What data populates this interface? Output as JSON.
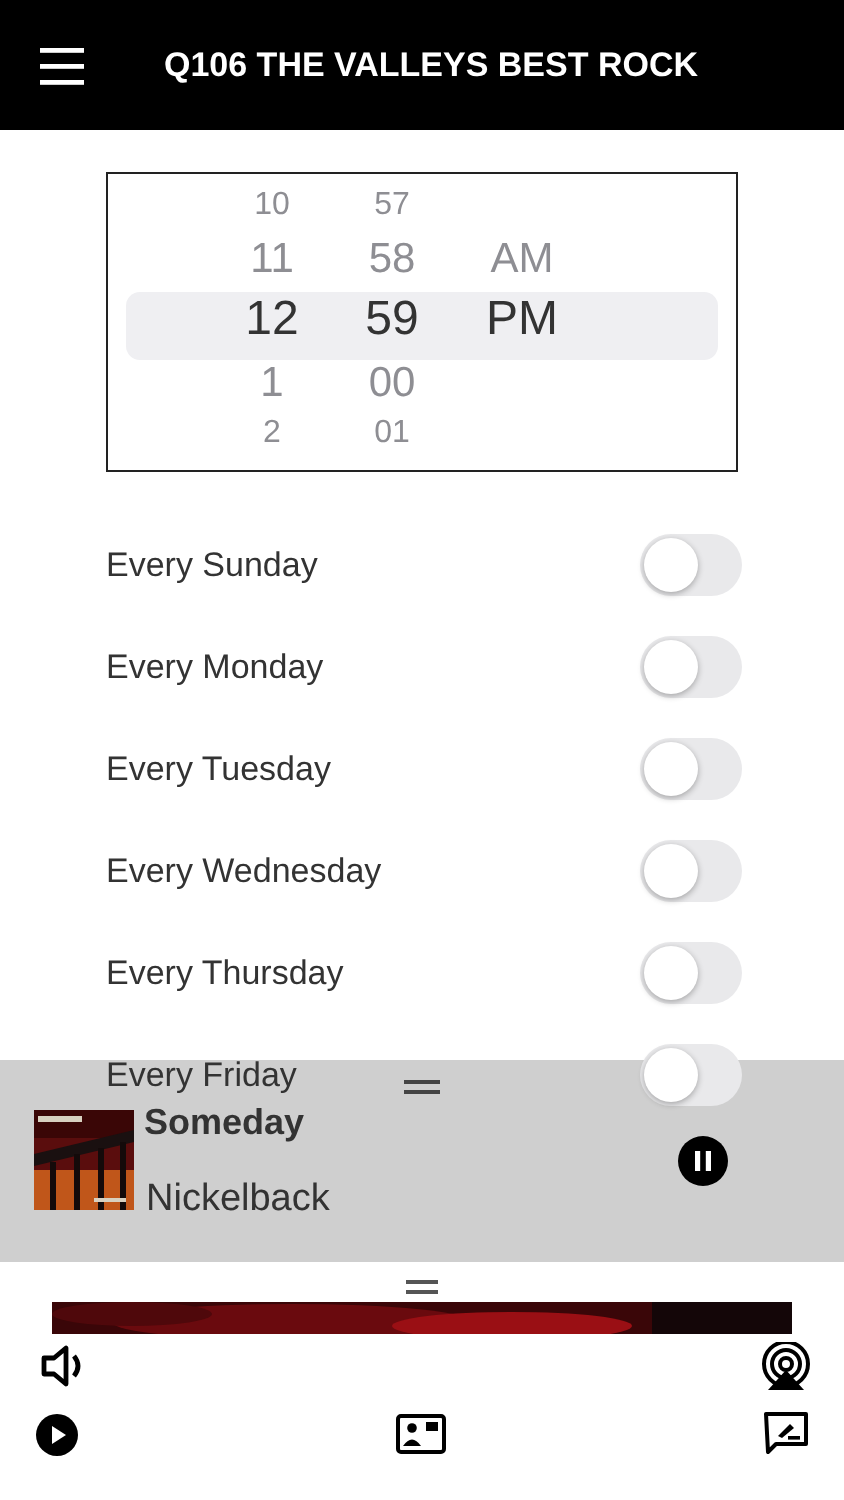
{
  "header": {
    "title": "Q106 THE VALLEYS BEST ROCK"
  },
  "time_picker": {
    "columns": [
      {
        "items": [
          {
            "label": "10",
            "selected": false
          },
          {
            "label": "11",
            "selected": false
          },
          {
            "label": "12",
            "selected": true
          },
          {
            "label": "1",
            "selected": false
          },
          {
            "label": "2",
            "selected": false
          }
        ]
      },
      {
        "items": [
          {
            "label": "57",
            "selected": false
          },
          {
            "label": "58",
            "selected": false
          },
          {
            "label": "59",
            "selected": true
          },
          {
            "label": "00",
            "selected": false
          },
          {
            "label": "01",
            "selected": false
          }
        ]
      },
      {
        "items": [
          {
            "label": "AM",
            "selected": false
          },
          {
            "label": "PM",
            "selected": true
          }
        ]
      }
    ]
  },
  "repeat_days": [
    {
      "label": "Every Sunday",
      "on": false
    },
    {
      "label": "Every Monday",
      "on": false
    },
    {
      "label": "Every Tuesday",
      "on": false
    },
    {
      "label": "Every Wednesday",
      "on": false
    },
    {
      "label": "Every Thursday",
      "on": false
    },
    {
      "label": "Every Friday",
      "on": false
    }
  ],
  "mini_player": {
    "title": "Someday",
    "artist": "Nickelback",
    "playing": true
  }
}
